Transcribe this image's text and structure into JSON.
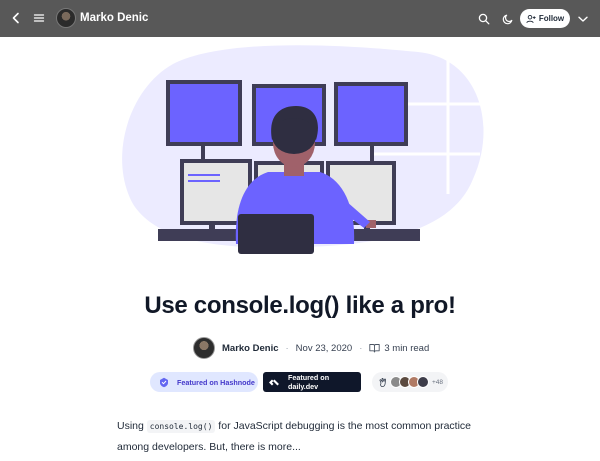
{
  "topbar": {
    "author_name": "Marko Denic",
    "follow_label": "Follow"
  },
  "icons": {
    "back": "chevron-left-icon",
    "menu": "hamburger-icon",
    "search": "search-icon",
    "theme": "moon-icon",
    "follow": "add-user-icon",
    "more": "chevron-down-icon"
  },
  "article": {
    "title": "Use console.log() like a pro!",
    "author": "Marko Denic",
    "date": "Nov 23, 2020",
    "read_time": "3 min read"
  },
  "badges": {
    "hashnode": "Featured on Hashnode",
    "dailydev": "Featured on daily.dev",
    "reaction_count": "+48"
  },
  "body": {
    "intro_before": "Using ",
    "intro_code": "console.log()",
    "intro_after": " for JavaScript debugging is the most common practice among developers. But, there is more..."
  },
  "colors": {
    "topbar": "#585858",
    "accent": "#6c63ff",
    "hashnode_badge_bg": "#e0e7ff",
    "dailydev_badge_bg": "#0f172a"
  }
}
